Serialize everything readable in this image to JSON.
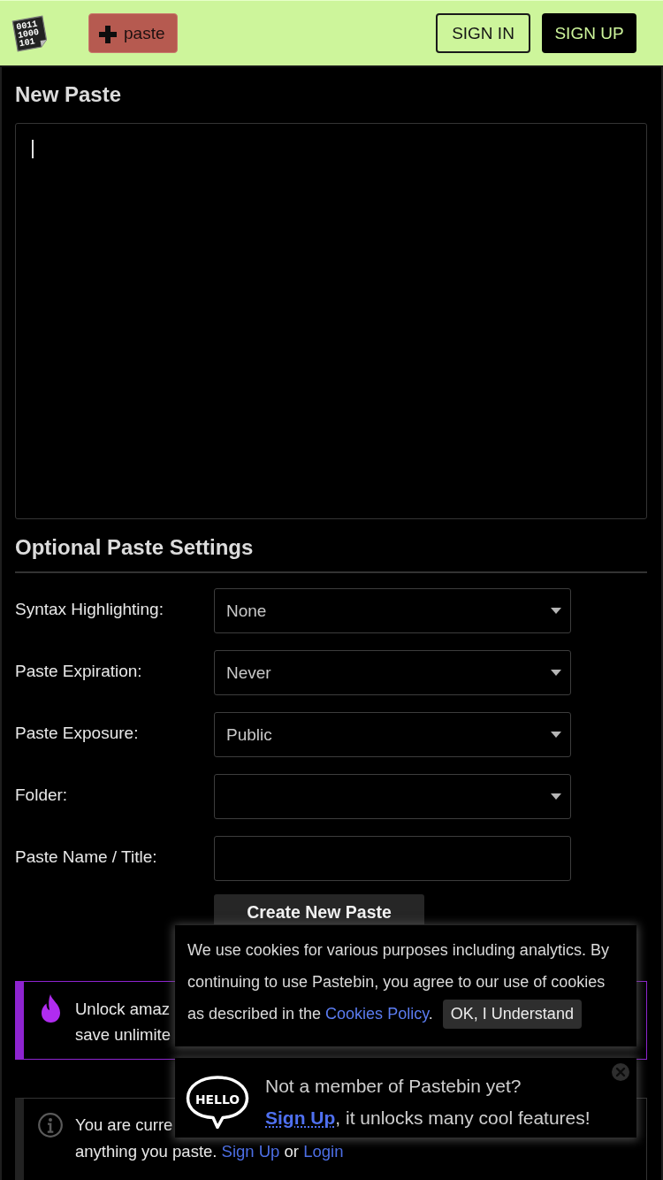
{
  "header": {
    "logo": {
      "lines": [
        "0011",
        "1000",
        "101"
      ]
    },
    "new_paste": {
      "label": "paste"
    },
    "sign_in": {
      "label": "SIGN IN"
    },
    "sign_up": {
      "label": "SIGN UP"
    }
  },
  "editor": {
    "title": "New Paste"
  },
  "settings": {
    "title": "Optional Paste Settings",
    "fields": [
      {
        "kind": "select",
        "label": "Syntax Highlighting:",
        "value": "None"
      },
      {
        "kind": "select",
        "label": "Paste Expiration:",
        "value": "Never"
      },
      {
        "kind": "select",
        "label": "Paste Exposure:",
        "value": "Public"
      },
      {
        "kind": "select",
        "label": "Folder:"
      },
      {
        "kind": "text",
        "label": "Paste Name / Title:"
      }
    ],
    "submit": {
      "label": "Create New Paste"
    }
  },
  "notices": [
    {
      "kind": "premium",
      "lines": [
        [
          {
            "kind": "text",
            "text": "Unlock amaz"
          }
        ],
        [
          {
            "kind": "text",
            "text": "save unlimite"
          }
        ]
      ]
    },
    {
      "kind": "info",
      "lines": [
        [
          {
            "kind": "text",
            "text": "You are curre"
          }
        ],
        [
          {
            "kind": "text",
            "text": "anything you paste. "
          },
          {
            "kind": "link",
            "text": "Sign Up"
          },
          {
            "kind": "text",
            "text": " or "
          },
          {
            "kind": "link",
            "text": "Login"
          }
        ]
      ]
    }
  ],
  "cookie_banner": {
    "message_lines": [
      [
        {
          "kind": "text",
          "text": "We use cookies for various purposes including analytics. By continuing to use Pastebin, you agree to our use of cookies"
        }
      ],
      [
        {
          "kind": "text",
          "text": "as described in the "
        },
        {
          "kind": "link",
          "text": "Cookies Policy"
        },
        {
          "kind": "text",
          "text": "."
        }
      ]
    ],
    "button": {
      "label": "OK, I Understand"
    }
  },
  "signup_banner": {
    "bubble": "HELLO",
    "title": "Not a member of Pastebin yet?",
    "message": [
      {
        "kind": "link",
        "text": "Sign Up"
      },
      {
        "kind": "text",
        "text": ", it unlocks many cool features!"
      }
    ]
  }
}
